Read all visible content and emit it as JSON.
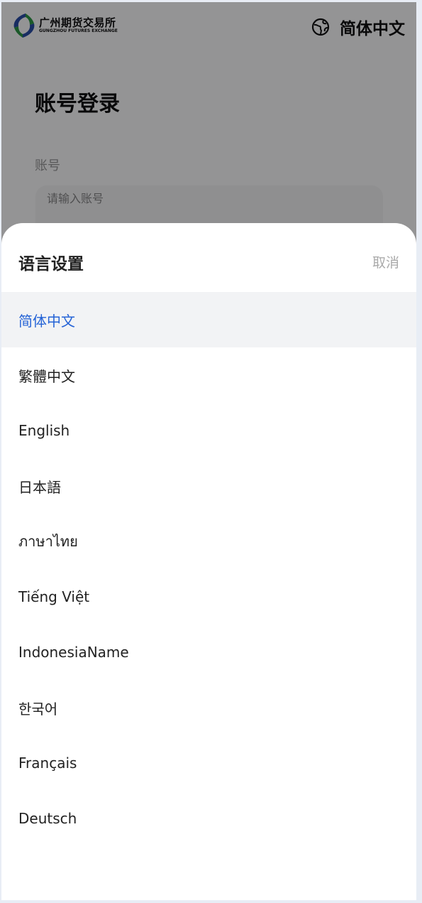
{
  "header": {
    "logo_cn": "广州期货交易所",
    "logo_en": "GUNGZHOU FUTURES EXCHANGE",
    "current_language": "简体中文",
    "globe_icon": "globe-icon"
  },
  "login": {
    "title": "账号登录",
    "account_label": "账号",
    "account_placeholder": "请输入账号",
    "account_value": ""
  },
  "language_sheet": {
    "title": "语言设置",
    "cancel_label": "取消",
    "selected_color": "#2563d6",
    "items": [
      {
        "label": "简体中文",
        "selected": true
      },
      {
        "label": "繁體中文",
        "selected": false
      },
      {
        "label": "English",
        "selected": false
      },
      {
        "label": "日本語",
        "selected": false
      },
      {
        "label": "ภาษาไทย",
        "selected": false
      },
      {
        "label": "Tiếng Việt",
        "selected": false
      },
      {
        "label": "IndonesiaName",
        "selected": false
      },
      {
        "label": "한국어",
        "selected": false
      },
      {
        "label": "Français",
        "selected": false
      },
      {
        "label": "Deutsch",
        "selected": false
      }
    ]
  }
}
